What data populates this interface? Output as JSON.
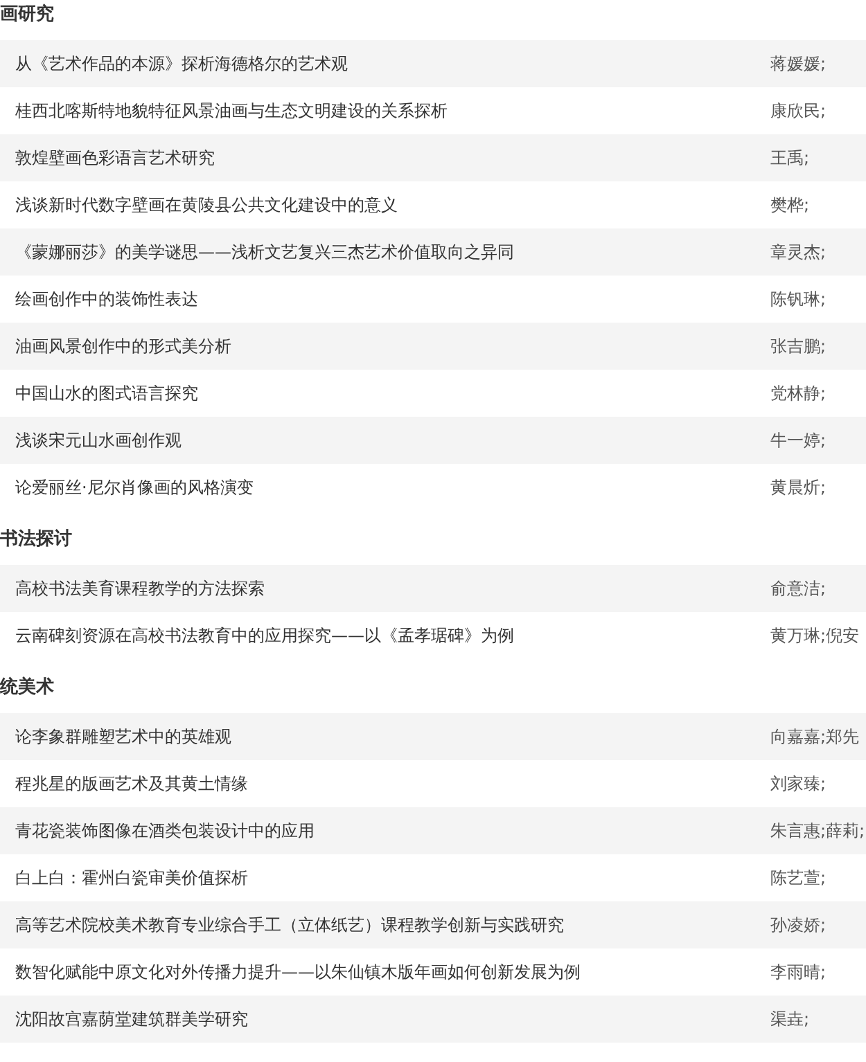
{
  "sections": [
    {
      "heading": "画研究",
      "articles": [
        {
          "title": "从《艺术作品的本源》探析海德格尔的艺术观",
          "authors": "蒋媛媛;"
        },
        {
          "title": "桂西北喀斯特地貌特征风景油画与生态文明建设的关系探析",
          "authors": "康欣民;"
        },
        {
          "title": "敦煌壁画色彩语言艺术研究",
          "authors": "王禹;"
        },
        {
          "title": "浅谈新时代数字壁画在黄陵县公共文化建设中的意义",
          "authors": "樊桦;"
        },
        {
          "title": "《蒙娜丽莎》的美学谜思——浅析文艺复兴三杰艺术价值取向之异同",
          "authors": "章灵杰;"
        },
        {
          "title": "绘画创作中的装饰性表达",
          "authors": "陈钒琳;"
        },
        {
          "title": "油画风景创作中的形式美分析",
          "authors": "张吉鹏;"
        },
        {
          "title": "中国山水的图式语言探究",
          "authors": "党林静;"
        },
        {
          "title": "浅谈宋元山水画创作观",
          "authors": "牛一婷;"
        },
        {
          "title": "论爱丽丝·尼尔肖像画的风格演变",
          "authors": "黄晨炘;"
        }
      ]
    },
    {
      "heading": "书法探讨",
      "articles": [
        {
          "title": "高校书法美育课程教学的方法探索",
          "authors": "俞意洁;"
        },
        {
          "title": "云南碑刻资源在高校书法教育中的应用探究——以《孟孝琚碑》为例",
          "authors": "黄万琳;倪安"
        }
      ]
    },
    {
      "heading": "统美术",
      "articles": [
        {
          "title": "论李象群雕塑艺术中的英雄观",
          "authors": "向嘉嘉;郑先"
        },
        {
          "title": "程兆星的版画艺术及其黄土情缘",
          "authors": "刘家臻;"
        },
        {
          "title": "青花瓷装饰图像在酒类包装设计中的应用",
          "authors": "朱言惠;薛莉;"
        },
        {
          "title": "白上白：霍州白瓷审美价值探析",
          "authors": "陈艺萱;"
        },
        {
          "title": "高等艺术院校美术教育专业综合手工（立体纸艺）课程教学创新与实践研究",
          "authors": "孙凌娇;"
        },
        {
          "title": "数智化赋能中原文化对外传播力提升——以朱仙镇木版年画如何创新发展为例",
          "authors": "李雨晴;"
        },
        {
          "title": "沈阳故宫嘉荫堂建筑群美学研究",
          "authors": "渠垚;"
        }
      ]
    }
  ]
}
